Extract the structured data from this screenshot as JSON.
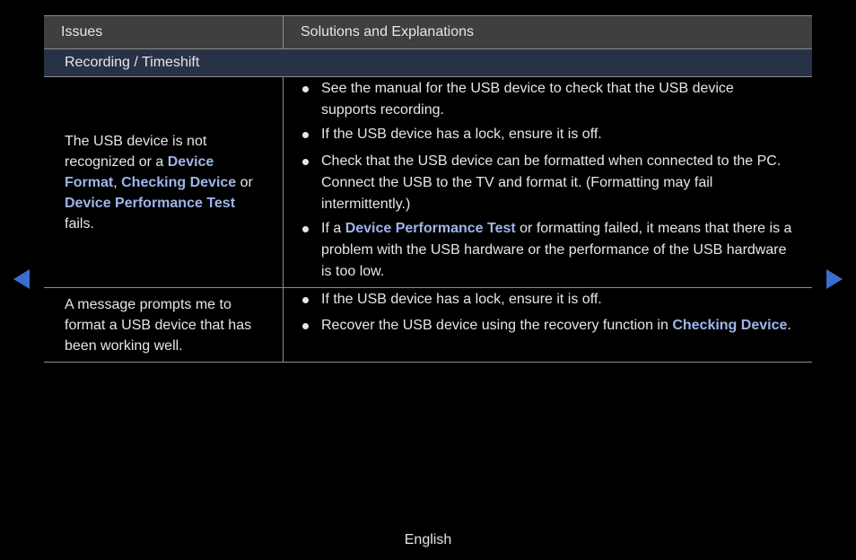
{
  "table": {
    "header": {
      "col1": "Issues",
      "col2": "Solutions and Explanations"
    },
    "section": "Recording / Timeshift",
    "rows": [
      {
        "issue": [
          {
            "text": "The USB device is not recognized or a ",
            "hl": false
          },
          {
            "text": "Device Format",
            "hl": true
          },
          {
            "text": ", ",
            "hl": false
          },
          {
            "text": "Checking Device",
            "hl": true
          },
          {
            "text": " or ",
            "hl": false
          },
          {
            "text": "Device Performance Test",
            "hl": true
          },
          {
            "text": " fails.",
            "hl": false
          }
        ],
        "solutions": [
          [
            {
              "text": "See the manual for the USB device to check that the USB device supports recording.",
              "hl": false
            }
          ],
          [
            {
              "text": "If the USB device has a lock, ensure it is off.",
              "hl": false
            }
          ],
          [
            {
              "text": "Check that the USB device can be formatted when connected to the PC. Connect the USB to the TV and format it. (Formatting may fail intermittently.)",
              "hl": false
            }
          ],
          [
            {
              "text": "If a ",
              "hl": false
            },
            {
              "text": "Device Performance Test",
              "hl": true
            },
            {
              "text": " or formatting failed, it means that there is a problem with the USB hardware or the performance of the USB hardware is too low.",
              "hl": false
            }
          ]
        ]
      },
      {
        "issue": [
          {
            "text": "A message prompts me to format a USB device that has been working well.",
            "hl": false
          }
        ],
        "solutions": [
          [
            {
              "text": "If the USB device has a lock, ensure it is off.",
              "hl": false
            }
          ],
          [
            {
              "text": "Recover the USB device using the recovery function in ",
              "hl": false
            },
            {
              "text": "Checking Device",
              "hl": true
            },
            {
              "text": ".",
              "hl": false
            }
          ]
        ]
      }
    ]
  },
  "nav": {
    "prev_icon": "triangle-left-icon",
    "next_icon": "triangle-right-icon",
    "color": "#3a6fd0"
  },
  "highlight_color": "#9fb4ea",
  "footer": {
    "language": "English"
  }
}
